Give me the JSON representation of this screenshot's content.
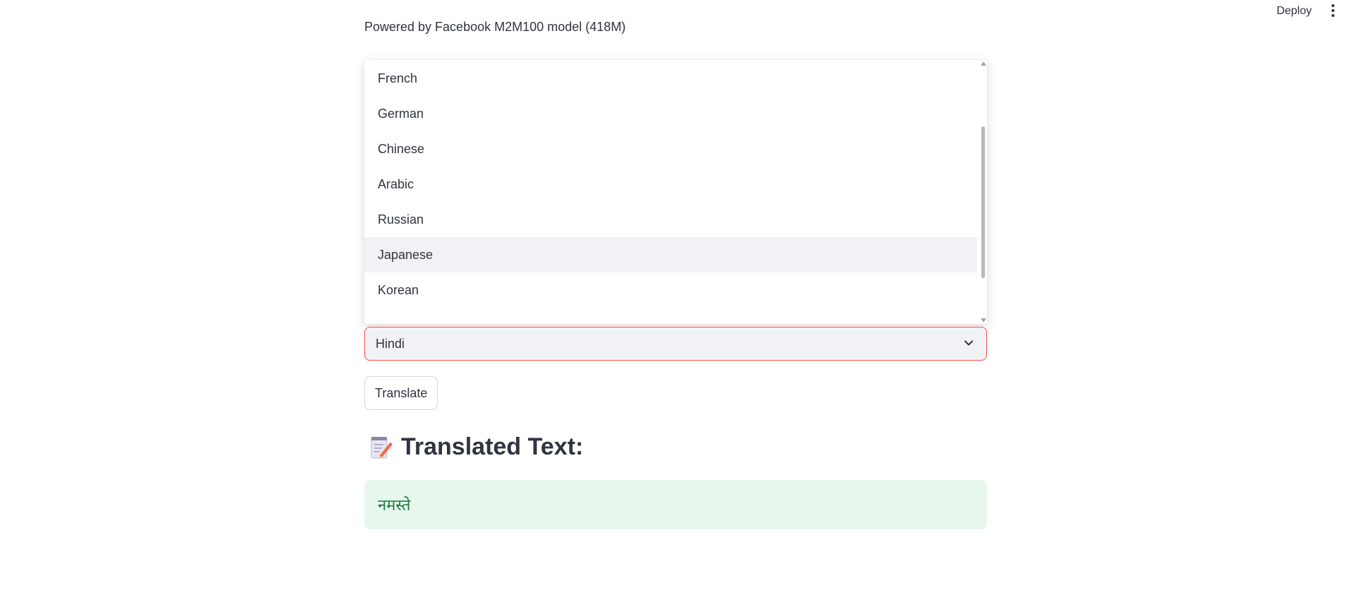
{
  "header": {
    "deploy_label": "Deploy",
    "menu_icon": "vertical-dots-icon"
  },
  "main": {
    "caption": "Powered by Facebook M2M100 model (418M)",
    "dropdown": {
      "options": [
        "French",
        "German",
        "Chinese",
        "Arabic",
        "Russian",
        "Japanese",
        "Korean"
      ],
      "highlighted": "Japanese"
    },
    "target_select": {
      "value": "Hindi",
      "border_color": "#ff4b4b"
    },
    "translate_button": "Translate",
    "result_heading": {
      "icon": "memo-icon",
      "text": "Translated Text:"
    },
    "result": {
      "text": "नमस्ते",
      "background": "#e8f7ee",
      "color": "#1c7a3c"
    }
  }
}
